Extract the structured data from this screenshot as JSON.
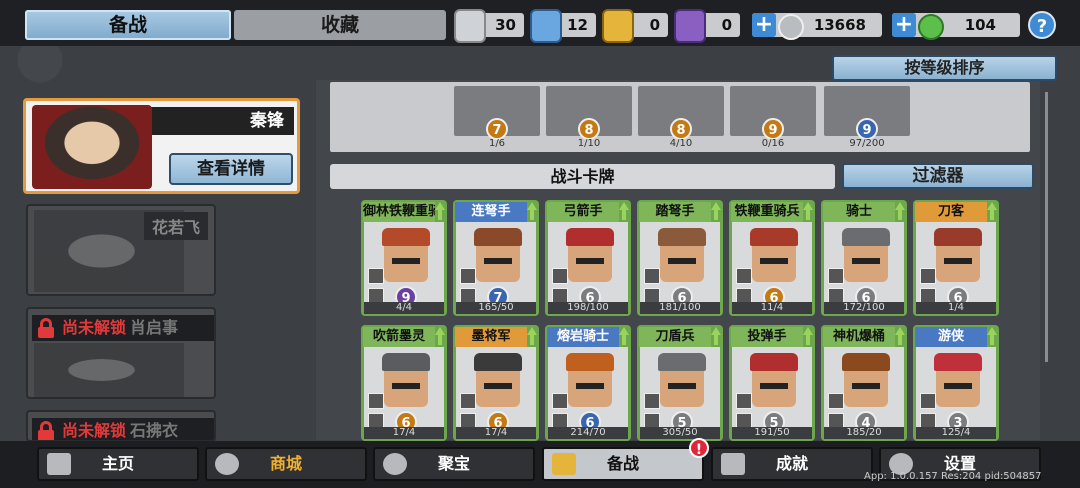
{
  "tabs": {
    "active": "备战",
    "inactive": "收藏"
  },
  "resources": [
    {
      "icon": "silver-crest-icon",
      "value": "30",
      "color": "#cfd2d6"
    },
    {
      "icon": "blue-crest-icon",
      "value": "12",
      "color": "#6aa6e0"
    },
    {
      "icon": "gold-crest-icon",
      "value": "0",
      "color": "#e5b43a"
    },
    {
      "icon": "purple-crest-icon",
      "value": "0",
      "color": "#8a5fc2"
    }
  ],
  "currency": [
    {
      "icon": "silver-coin-icon",
      "value": "13668",
      "color": "#b9bcc0"
    },
    {
      "icon": "green-gem-icon",
      "value": "104",
      "color": "#5cbf4a"
    }
  ],
  "help_label": "?",
  "sort_button": "按等级排序",
  "heroes": {
    "selected": {
      "name": "秦锋",
      "details_button": "查看详情"
    },
    "second": {
      "name": "花若飞"
    },
    "locked": [
      {
        "status": "尚未解锁",
        "name": "肖启事"
      },
      {
        "status": "尚未解锁",
        "name": "石拂衣"
      }
    ]
  },
  "shelf": [
    {
      "level": "7",
      "count": "1/6"
    },
    {
      "level": "8",
      "count": "1/10"
    },
    {
      "level": "8",
      "count": "4/10"
    },
    {
      "level": "9",
      "count": "0/16"
    },
    {
      "level": "9",
      "count": "97/200"
    }
  ],
  "section_title": "战斗卡牌",
  "filter_button": "过滤器",
  "cards_row1": [
    {
      "name": "御林铁鞭重骑",
      "level": "9",
      "count": "4/4",
      "tier": "green",
      "lvcolor": "#6b3fa0",
      "skin": "#b34a2a"
    },
    {
      "name": "连弩手",
      "level": "7",
      "count": "165/50",
      "tier": "blue",
      "lvcolor": "#3a66b0",
      "skin": "#8a4a2a"
    },
    {
      "name": "弓箭手",
      "level": "6",
      "count": "198/100",
      "tier": "green",
      "lvcolor": "#7a7c80",
      "skin": "#b02e2e"
    },
    {
      "name": "踏弩手",
      "level": "6",
      "count": "181/100",
      "tier": "green",
      "lvcolor": "#7a7c80",
      "skin": "#8a5a3a"
    },
    {
      "name": "铁鞭重骑兵",
      "level": "6",
      "count": "11/4",
      "tier": "green",
      "lvcolor": "#c47a14",
      "skin": "#a83a2a"
    },
    {
      "name": "骑士",
      "level": "6",
      "count": "172/100",
      "tier": "green",
      "lvcolor": "#7a7c80",
      "skin": "#6a6c70"
    },
    {
      "name": "刀客",
      "level": "6",
      "count": "1/4",
      "tier": "orange",
      "lvcolor": "#7a7c80",
      "skin": "#9a3a2a"
    }
  ],
  "cards_row2": [
    {
      "name": "吹箭墨灵",
      "level": "6",
      "count": "17/4",
      "tier": "green",
      "lvcolor": "#c47a14",
      "skin": "#5a5c60"
    },
    {
      "name": "墨将军",
      "level": "6",
      "count": "17/4",
      "tier": "orange",
      "lvcolor": "#c47a14",
      "skin": "#3a3a3a"
    },
    {
      "name": "熔岩骑士",
      "level": "6",
      "count": "214/70",
      "tier": "blue",
      "lvcolor": "#3a66b0",
      "skin": "#c0601e"
    },
    {
      "name": "刀盾兵",
      "level": "5",
      "count": "305/50",
      "tier": "green",
      "lvcolor": "#7a7c80",
      "skin": "#6a6c70"
    },
    {
      "name": "投弹手",
      "level": "5",
      "count": "191/50",
      "tier": "green",
      "lvcolor": "#7a7c80",
      "skin": "#b02e2e"
    },
    {
      "name": "神机爆桶",
      "level": "4",
      "count": "185/20",
      "tier": "green",
      "lvcolor": "#7a7c80",
      "skin": "#8a4a1e"
    },
    {
      "name": "游侠",
      "level": "3",
      "count": "125/4",
      "tier": "blue",
      "lvcolor": "#7a7c80",
      "skin": "#c0303a"
    }
  ],
  "nav": [
    {
      "label": "主页",
      "icon": "home-icon"
    },
    {
      "label": "商城",
      "icon": "shop-coins-icon"
    },
    {
      "label": "聚宝",
      "icon": "treasure-bowl-icon"
    },
    {
      "label": "备战",
      "icon": "cards-icon"
    },
    {
      "label": "成就",
      "icon": "achievements-icon"
    },
    {
      "label": "设置",
      "icon": "gear-icon"
    }
  ],
  "nav_badge": "!",
  "version_text": "App: 1.0.0.157 Res:204 pid:504857"
}
